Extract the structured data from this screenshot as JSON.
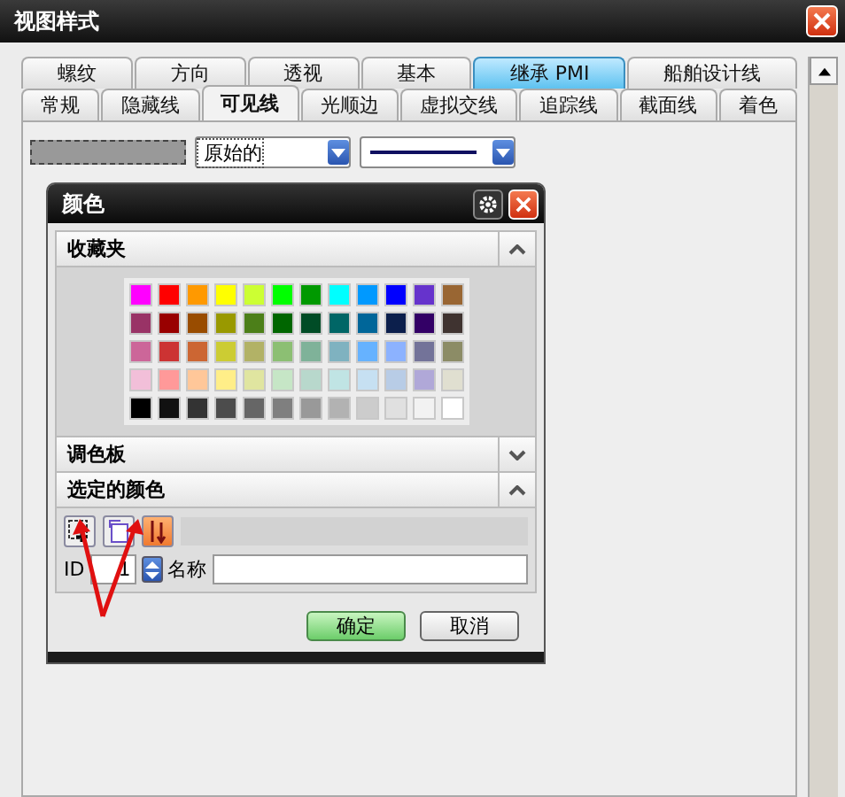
{
  "window": {
    "title": "视图样式"
  },
  "tab_rows": [
    [
      {
        "label": "螺纹",
        "selected": false,
        "highlighted": false
      },
      {
        "label": "方向",
        "selected": false,
        "highlighted": false
      },
      {
        "label": "透视",
        "selected": false,
        "highlighted": false
      },
      {
        "label": "基本",
        "selected": false,
        "highlighted": false
      },
      {
        "label": "继承 PMI",
        "selected": false,
        "highlighted": true
      },
      {
        "label": "船舶设计线",
        "selected": false,
        "highlighted": false
      }
    ],
    [
      {
        "label": "常规",
        "selected": false,
        "highlighted": false
      },
      {
        "label": "隐藏线",
        "selected": false,
        "highlighted": false
      },
      {
        "label": "可见线",
        "selected": true,
        "highlighted": false
      },
      {
        "label": "光顺边",
        "selected": false,
        "highlighted": false
      },
      {
        "label": "虚拟交线",
        "selected": false,
        "highlighted": false
      },
      {
        "label": "追踪线",
        "selected": false,
        "highlighted": false
      },
      {
        "label": "截面线",
        "selected": false,
        "highlighted": false
      },
      {
        "label": "着色",
        "selected": false,
        "highlighted": false
      }
    ]
  ],
  "line_settings": {
    "color_value": "原始的"
  },
  "color_dialog": {
    "title": "颜色",
    "sections": [
      {
        "kind": "favorites",
        "label": "收藏夹",
        "expanded": true
      },
      {
        "kind": "palette",
        "label": "调色板",
        "expanded": false
      },
      {
        "kind": "selected",
        "label": "选定的颜色",
        "expanded": true
      }
    ],
    "swatches": [
      {
        "color": "#ff00ff"
      },
      {
        "color": "#ff0000"
      },
      {
        "color": "#ff9900"
      },
      {
        "color": "#ffff00"
      },
      {
        "color": "#ccff33"
      },
      {
        "color": "#00ff00"
      },
      {
        "color": "#009900"
      },
      {
        "color": "#00ffff"
      },
      {
        "color": "#0099ff"
      },
      {
        "color": "#0000ff"
      },
      {
        "color": "#6633cc"
      },
      {
        "color": "#996633"
      },
      {
        "color": "#993366"
      },
      {
        "color": "#990000"
      },
      {
        "color": "#994c00"
      },
      {
        "color": "#999900"
      },
      {
        "color": "#4c7f19"
      },
      {
        "color": "#006600"
      },
      {
        "color": "#004c26"
      },
      {
        "color": "#006666"
      },
      {
        "color": "#006699"
      },
      {
        "color": "#0c1f4c"
      },
      {
        "color": "#330066"
      },
      {
        "color": "#3f3330"
      },
      {
        "color": "#cc6699"
      },
      {
        "color": "#cc3333"
      },
      {
        "color": "#cc6633"
      },
      {
        "color": "#cccc33"
      },
      {
        "color": "#b2b266"
      },
      {
        "color": "#8cbf73"
      },
      {
        "color": "#7fb299"
      },
      {
        "color": "#7fb2c0"
      },
      {
        "color": "#66b2ff"
      },
      {
        "color": "#8cb2ff"
      },
      {
        "color": "#737399"
      },
      {
        "color": "#8c8c66"
      },
      {
        "color": "#f2bfd9"
      },
      {
        "color": "#ff9999"
      },
      {
        "color": "#ffc799"
      },
      {
        "color": "#ffee88"
      },
      {
        "color": "#e0e5a0"
      },
      {
        "color": "#c6e6c6"
      },
      {
        "color": "#b8d8cc"
      },
      {
        "color": "#c0e4e4"
      },
      {
        "color": "#c6e0f2"
      },
      {
        "color": "#b8cce6"
      },
      {
        "color": "#b0a8d8"
      },
      {
        "color": "#e0dfd0"
      },
      {
        "color": "#000000"
      },
      {
        "color": "#111111"
      },
      {
        "color": "#333333"
      },
      {
        "color": "#4c4c4c"
      },
      {
        "color": "#666666"
      },
      {
        "color": "#7f7f7f"
      },
      {
        "color": "#999999"
      },
      {
        "color": "#b2b2b2"
      },
      {
        "color": "#cccccc"
      },
      {
        "color": "#e0e0e0"
      },
      {
        "color": "#f2f2f2"
      },
      {
        "color": "#ffffff"
      }
    ],
    "id_label": "ID",
    "id_value": "1",
    "name_label": "名称",
    "buttons": [
      {
        "label": "确定",
        "kind": "primary"
      },
      {
        "label": "取消",
        "kind": "normal"
      }
    ]
  }
}
